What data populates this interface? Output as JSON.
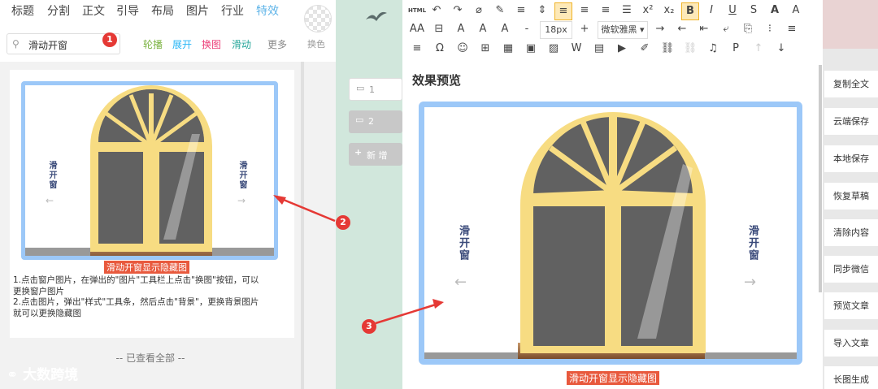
{
  "nav": {
    "tabs": [
      "标题",
      "分割",
      "正文",
      "引导",
      "布局",
      "图片",
      "行业",
      "特效"
    ],
    "active_tab": "特效",
    "search_value": "滑动开窗",
    "filters": [
      "轮播",
      "展开",
      "换图",
      "滑动",
      "更多"
    ],
    "filter_colors": [
      "#7cb342",
      "#29b6f6",
      "#ec407a",
      "#26a69a",
      "#888888"
    ],
    "color_label": "换色"
  },
  "badges": [
    "1",
    "2",
    "3"
  ],
  "thumb": {
    "left_text": "滑开窗",
    "right_text": "滑开窗",
    "caption": "滑动开窗显示隐藏图"
  },
  "instructions": [
    "1.点击窗户图片，在弹出的\"图片\"工具栏上点击\"换图\"按钮，可以",
    "更换窗户图片",
    "2.点击图片，弹出\"样式\"工具条，然后点击\"背景\"，更换背景图片",
    "就可以更换隐藏图"
  ],
  "see_all": "-- 已查看全部 --",
  "logo": "大数跨境",
  "pages": {
    "page1": "1",
    "page2": "2",
    "new_page": "新 增"
  },
  "toolbar": {
    "html_label": "HTML",
    "font_size": "18px",
    "font_family": "微软雅黑",
    "row1_icons": [
      "undo-icon",
      "redo-icon",
      "clear-format-icon",
      "format-brush-icon",
      "indent-icon",
      "line-height-icon",
      "align-left-icon",
      "align-center-icon",
      "align-right-icon",
      "justify-icon",
      "superscript-icon",
      "subscript-icon",
      "bold-icon",
      "italic-icon",
      "underline-icon",
      "strikethrough-icon",
      "border-icon",
      "font-color-icon"
    ],
    "row2_icons": [
      "letter-spacing-icon",
      "strike-box-icon",
      "strike-a-icon",
      "font-size-icon",
      "bg-color-icon",
      "minus-icon",
      "font-size-value",
      "plus-icon",
      "font-family-select",
      "circle-right-icon",
      "circle-left-icon",
      "indent-left-icon",
      "wrap-icon",
      "copy-icon",
      "list-icon",
      "paragraph-align-icon"
    ],
    "row3_icons": [
      "paragraph-icon",
      "omega-icon",
      "emoji-icon",
      "template-icon",
      "table-icon",
      "image-icon",
      "pattern-icon",
      "word-icon",
      "doc-icon",
      "video-icon",
      "brush-icon",
      "link-icon",
      "unlink-icon",
      "music-icon",
      "p-icon",
      "arrow-up-icon",
      "arrow-down-icon"
    ]
  },
  "preview": {
    "title": "效果预览",
    "left_text": "滑开窗",
    "right_text": "滑开窗",
    "caption": "滑动开窗显示隐藏图"
  },
  "side_buttons": [
    "复制全文",
    "云端保存",
    "本地保存",
    "恢复草稿",
    "清除内容",
    "同步微信",
    "预览文章",
    "导入文章",
    "长图生成"
  ],
  "colors": {
    "accent": "#5fb4e8",
    "frame": "#9cc8f8",
    "window_frame": "#f7dc82",
    "arrow_red": "#e53935"
  }
}
